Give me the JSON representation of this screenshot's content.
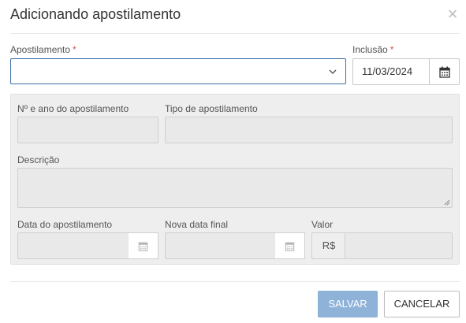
{
  "dialog": {
    "title": "Adicionando apostilamento",
    "close_label": "×"
  },
  "form": {
    "apostilamento_label": "Apostilamento",
    "apostilamento_value": "",
    "inclusao_label": "Inclusão",
    "inclusao_value": "11/03/2024",
    "required_marker": "*",
    "numero_ano_label": "Nº e ano do apostilamento",
    "tipo_label": "Tipo de apostilamento",
    "descricao_label": "Descrição",
    "data_label": "Data do apostilamento",
    "nova_data_label": "Nova data final",
    "valor_label": "Valor",
    "currency_prefix": "R$"
  },
  "footer": {
    "save_label": "SALVAR",
    "cancel_label": "CANCELAR"
  },
  "icons": {
    "close": "close-icon",
    "chevron": "chevron-down-icon",
    "calendar": "calendar-icon"
  },
  "colors": {
    "primary_disabled": "#8fb2d8",
    "focus_border": "#3c6fa8",
    "required": "#d9534f",
    "panel_bg": "#eeeeee"
  }
}
